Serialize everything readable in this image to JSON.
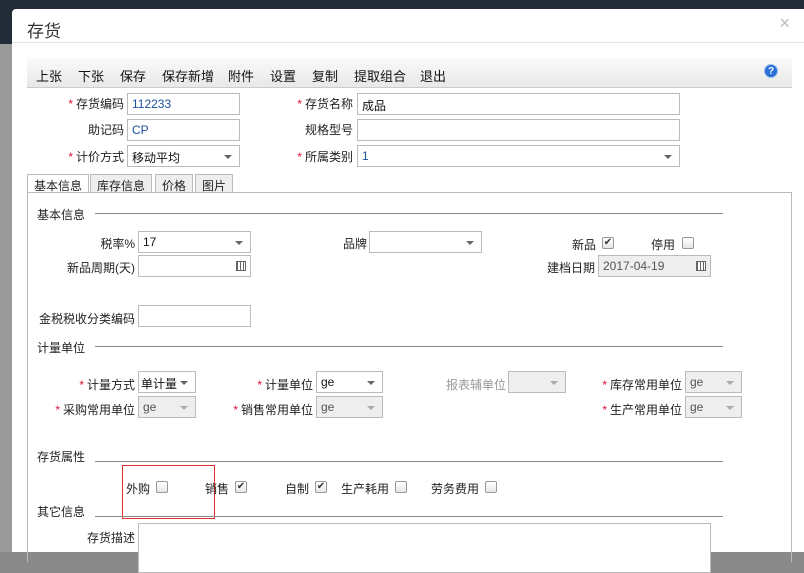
{
  "dialog": {
    "title": "存货",
    "close": "×"
  },
  "toolbar": [
    "上张",
    "下张",
    "保存",
    "保存新增",
    "附件",
    "设置",
    "复制",
    "提取组合",
    "退出"
  ],
  "help": "?",
  "header": {
    "code_label": "存货编码",
    "code": "112233",
    "name_label": "存货名称",
    "name": "成品",
    "mnemonic_label": "助记码",
    "mnemonic": "CP",
    "spec_label": "规格型号",
    "spec": "",
    "pricing_label": "计价方式",
    "pricing": "移动平均",
    "category_label": "所属类别",
    "category": "1"
  },
  "tabs": [
    "基本信息",
    "库存信息",
    "价格",
    "图片"
  ],
  "basic": {
    "section": "基本信息",
    "tax_label": "税率%",
    "tax": "17",
    "brand_label": "品牌",
    "brand": "",
    "new_label": "新品",
    "new_checked": true,
    "disabled_label": "停用",
    "disabled_checked": false,
    "cycle_label": "新品周期(天)",
    "cycle": "",
    "created_label": "建档日期",
    "created": "2017-04-19",
    "taxcode_label": "金税税收分类编码",
    "taxcode": ""
  },
  "units": {
    "section": "计量单位",
    "method_label": "计量方式",
    "method": "单计量",
    "unit_label": "计量单位",
    "unit": "ge",
    "report_label": "报表辅单位",
    "report": "",
    "stock_label": "库存常用单位",
    "stock": "ge",
    "purchase_label": "采购常用单位",
    "purchase": "ge",
    "sales_label": "销售常用单位",
    "sales": "ge",
    "production_label": "生产常用单位",
    "production": "ge"
  },
  "attrs": {
    "section": "存货属性",
    "items": [
      {
        "label": "外购",
        "checked": false
      },
      {
        "label": "销售",
        "checked": true
      },
      {
        "label": "自制",
        "checked": true
      },
      {
        "label": "生产耗用",
        "checked": false
      },
      {
        "label": "劳务费用",
        "checked": false
      }
    ]
  },
  "other": {
    "section": "其它信息",
    "desc_label": "存货描述",
    "desc": ""
  },
  "check_mark": "✔"
}
